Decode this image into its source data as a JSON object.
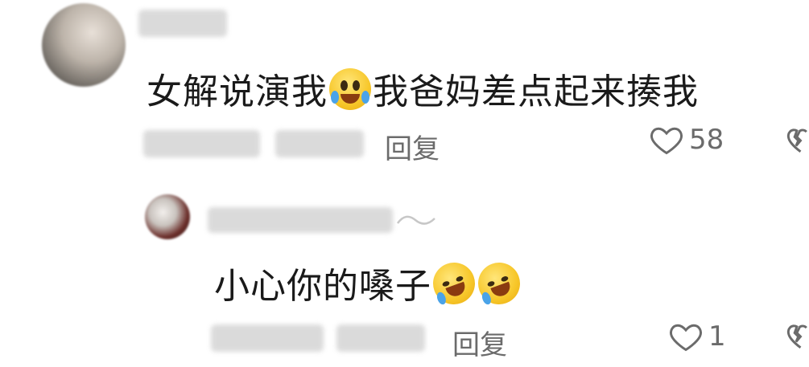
{
  "comment": {
    "text_before_emoji": "女解说演我",
    "text_after_emoji": "我爸妈差点起来揍我",
    "emoji_icon": "crying-laughing-emoji",
    "reply_label": "回复",
    "like_count": "58"
  },
  "reply": {
    "text": "小心你的嗓子",
    "emoji_icons": [
      "rolling-laughing-emoji",
      "rolling-laughing-emoji"
    ],
    "reply_label": "回复",
    "like_count": "1"
  },
  "colors": {
    "meta_text": "#6b6b6b",
    "content_text": "#1a1a1a",
    "emoji_yellow": "#f7c72a"
  }
}
